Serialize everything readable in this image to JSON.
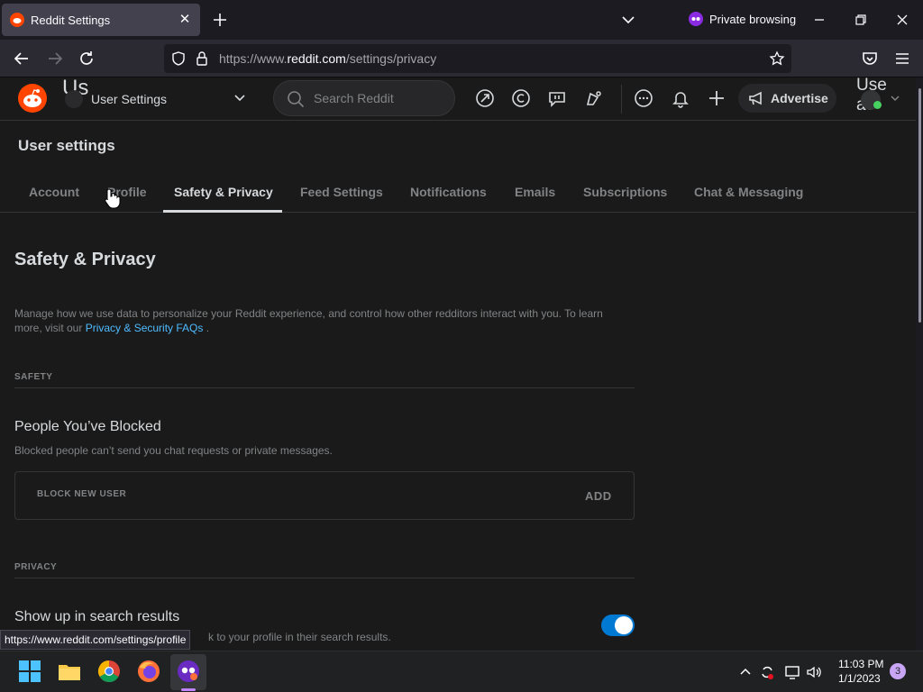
{
  "browser": {
    "tab_title": "Reddit Settings",
    "private_label": "Private browsing",
    "url_prefix": "https://www.",
    "url_host": "reddit.com",
    "url_path": "/settings/privacy",
    "status_link": "https://www.reddit.com/settings/profile"
  },
  "header": {
    "ghost_title": "Us",
    "context_label": "User Settings",
    "search_placeholder": "Search Reddit",
    "advertise_label": "Advertise",
    "user_ghost": "Use\nav",
    "icons": [
      "popular-icon",
      "coins-icon",
      "chat-bubble-icon",
      "talk-icon",
      "messages-icon",
      "notifications-icon",
      "create-post-icon"
    ]
  },
  "settings": {
    "heading": "User settings",
    "tabs": [
      "Account",
      "Profile",
      "Safety & Privacy",
      "Feed Settings",
      "Notifications",
      "Emails",
      "Subscriptions",
      "Chat & Messaging"
    ],
    "active_tab": "Safety & Privacy",
    "section_title": "Safety & Privacy",
    "intro_text": "Manage how we use data to personalize your Reddit experience, and control how other redditors interact with you. To learn more, visit our ",
    "intro_link": "Privacy & Security FAQs",
    "intro_end": " .",
    "safety_label": "SAFETY",
    "blocked_title": "People You’ve Blocked",
    "blocked_desc": "Blocked people can’t send you chat requests or private messages.",
    "block_placeholder": "BLOCK NEW USER",
    "add_label": "ADD",
    "privacy_label": "PRIVACY",
    "search_results_title": "Show up in search results",
    "search_results_desc": "k to your profile in their search results.",
    "search_results_enabled": true
  },
  "taskbar": {
    "apps": [
      "windows-start-icon",
      "file-explorer-icon",
      "chrome-icon",
      "firefox-icon",
      "firefox-private-icon"
    ],
    "time": "11:03 PM",
    "date": "1/1/2023",
    "notification_count": "3"
  },
  "colors": {
    "reddit_orange": "#ff4500",
    "toggle_blue": "#0079d3",
    "link_blue": "#4fbcff"
  }
}
